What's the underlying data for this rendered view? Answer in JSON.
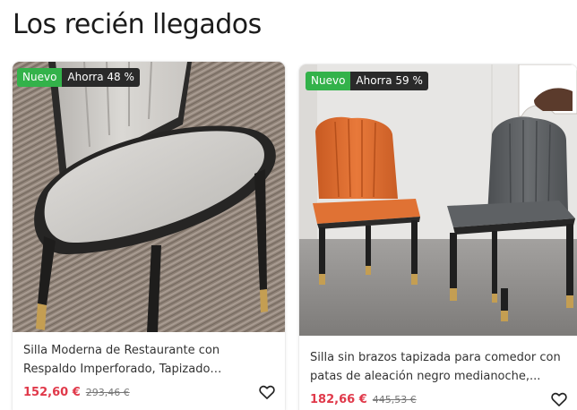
{
  "section": {
    "title": "Los recién llegados"
  },
  "products": [
    {
      "badge_new": "Nuevo",
      "badge_save": "Ahorra 48 %",
      "title": "Silla Moderna de Restaurante con Respaldo Imperforado, Tapizado Acolchado, Patas de...",
      "price": "152,60 €",
      "old_price": "293,46 €",
      "wishlist_icon": "heart-outline-icon",
      "colors": {
        "upholstery": "#cfcdca",
        "legs": "#222222",
        "feet": "#c4a25a",
        "rug": "#8a7b70"
      }
    },
    {
      "badge_new": "Nuevo",
      "badge_save": "Ahorra 59 %",
      "title": "Silla sin brazos tapizada para comedor con patas de aleación negro medianoche,...",
      "price": "182,66 €",
      "old_price": "445,53 €",
      "wishlist_icon": "heart-outline-icon",
      "colors": {
        "chair_left": "#d9692c",
        "chair_right": "#5a5d60",
        "wall": "#e9e8e6",
        "floor": "#8e8c8a"
      }
    }
  ],
  "colors": {
    "badge_new": "#33b24a",
    "badge_save": "#2a2a2a",
    "price": "#e0394a"
  }
}
